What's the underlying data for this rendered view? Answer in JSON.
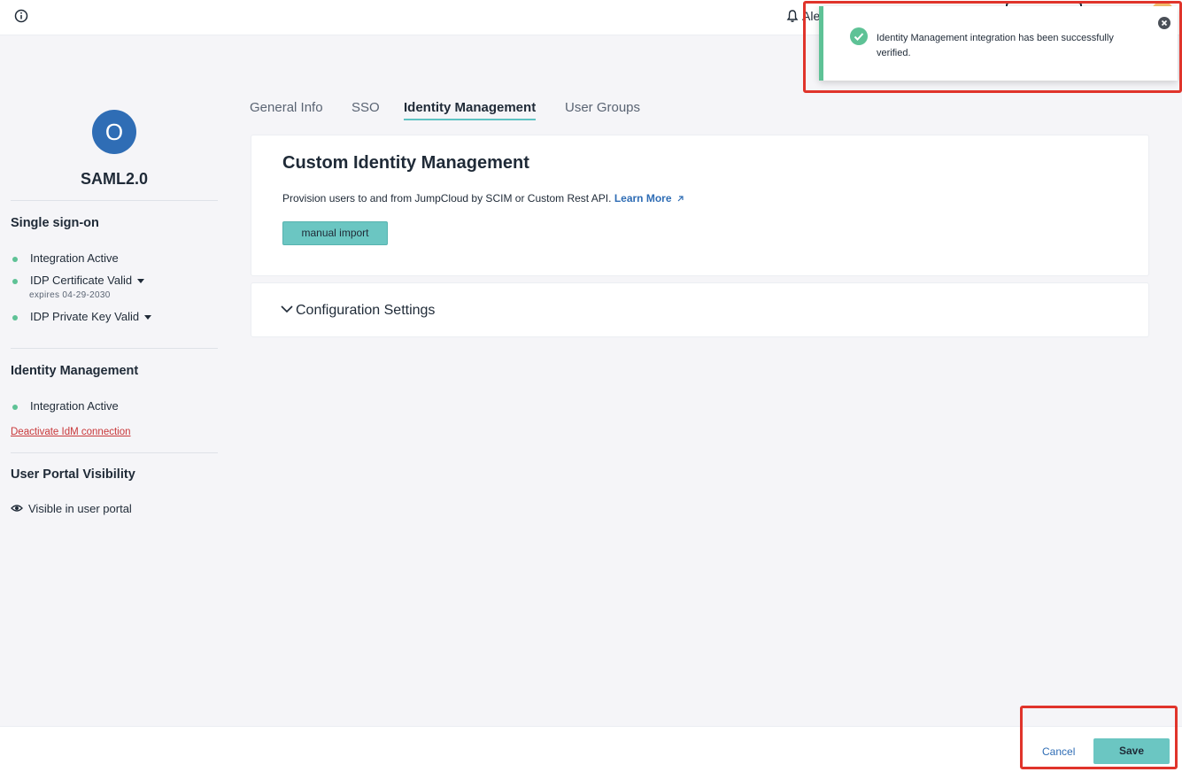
{
  "topbar": {
    "info_icon": "info-circle-icon",
    "bell_icon": "bell-icon",
    "alerts_label": "Ale"
  },
  "toast": {
    "message": "Identity Management integration has been successfully verified.",
    "status_color": "#5ec296",
    "check_icon": "check-circle-icon",
    "close_icon": "close-circle-icon"
  },
  "sidebar": {
    "avatar_letter": "O",
    "avatar_color": "#2f6db5",
    "app_name": "SAML2.0",
    "sso": {
      "title": "Single sign-on",
      "items": [
        {
          "label": "Integration Active"
        },
        {
          "label": "IDP Certificate Valid",
          "sub": "expires 04-29-2030"
        },
        {
          "label": "IDP Private Key Valid"
        }
      ]
    },
    "idm": {
      "title": "Identity Management",
      "status": "Integration Active",
      "deactivate_link": "Deactivate IdM connection"
    },
    "portal": {
      "title": "User Portal Visibility",
      "status": "Visible in user portal"
    }
  },
  "tabs": [
    {
      "label": "General Info",
      "active": false
    },
    {
      "label": "SSO",
      "active": false
    },
    {
      "label": "Identity Management",
      "active": true
    },
    {
      "label": "User Groups",
      "active": false
    }
  ],
  "main": {
    "custom_idm": {
      "title": "Custom Identity Management",
      "description": "Provision users to and from JumpCloud by SCIM or Custom Rest API.",
      "learn_more": "Learn More",
      "manual_import_label": "manual import"
    },
    "config": {
      "title": "Configuration Settings"
    }
  },
  "footer": {
    "cancel_label": "Cancel",
    "save_label": "Save"
  },
  "colors": {
    "accent_teal": "#6bc6c2",
    "link_blue": "#2f6db5",
    "success_green": "#5ec296",
    "highlight_red": "#e0342b"
  }
}
